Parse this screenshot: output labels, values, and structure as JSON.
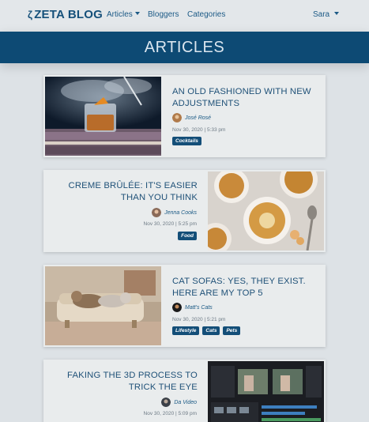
{
  "nav": {
    "brand": "ZETA BLOG",
    "links": [
      {
        "label": "Articles",
        "dropdown": true
      },
      {
        "label": "Bloggers",
        "dropdown": false
      },
      {
        "label": "Categories",
        "dropdown": false
      }
    ],
    "user": "Sara"
  },
  "banner": {
    "title": "ARTICLES"
  },
  "articles": [
    {
      "title": "AN OLD FASHIONED WITH NEW ADJUSTMENTS",
      "author": "José Rosé",
      "date": "Nov 30, 2020 | 5:33 pm",
      "tags": [
        "Cocktails"
      ],
      "image": "cocktail-photo"
    },
    {
      "title": "CREME BRÛLÉE: IT'S EASIER THAN YOU THINK",
      "author": "Jenna Cooks",
      "date": "Nov 30, 2020 | 5:25 pm",
      "tags": [
        "Food"
      ],
      "image": "creme-brulee-photo"
    },
    {
      "title": "CAT SOFAS: YES, THEY EXIST. HERE ARE MY TOP 5",
      "author": "Matt's Cats",
      "date": "Nov 30, 2020 | 5:21 pm",
      "tags": [
        "Lifestyle",
        "Cats",
        "Pets"
      ],
      "image": "cat-sofa-photo"
    },
    {
      "title": "FAKING THE 3D PROCESS TO TRICK THE EYE",
      "author": "Da Video",
      "date": "Nov 30, 2020 | 5:09 pm",
      "tags": [],
      "image": "video-editor-photo"
    }
  ],
  "colors": {
    "brand": "#15507a",
    "banner": "#0d4a74",
    "tag": "#134e78",
    "page_bg": "#dde2e6"
  }
}
